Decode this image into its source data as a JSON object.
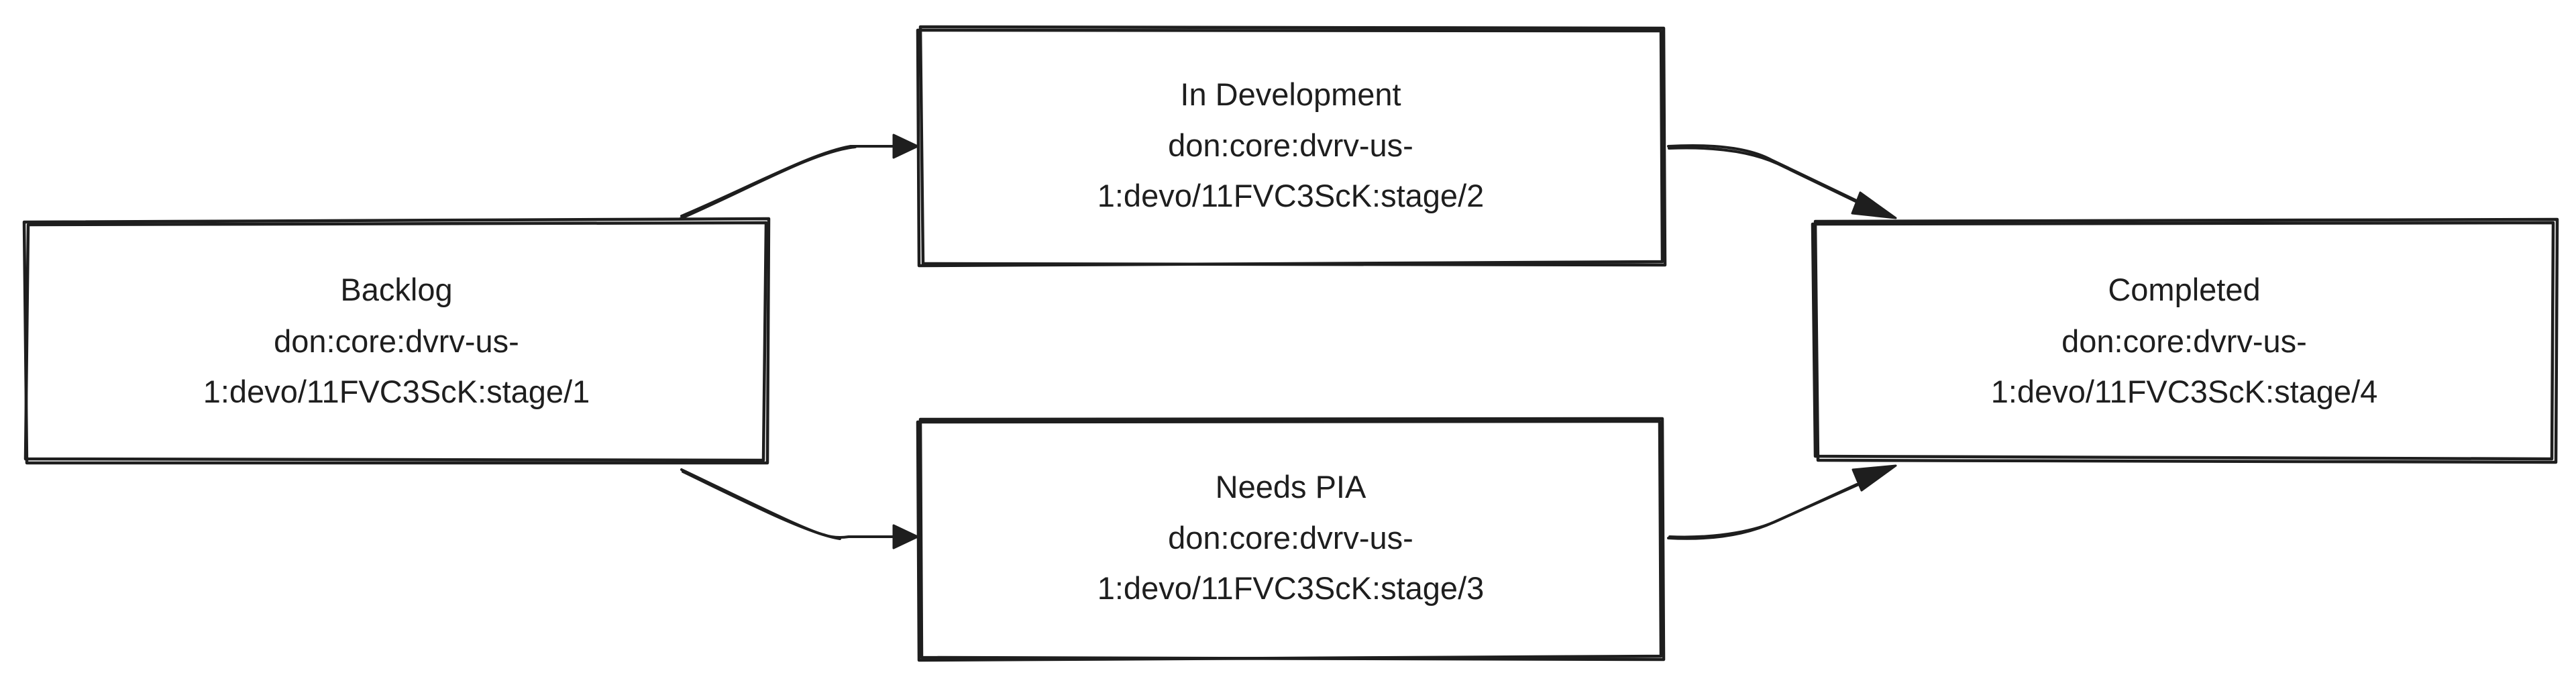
{
  "diagram": {
    "nodes": [
      {
        "id": "backlog",
        "title": "Backlog",
        "line2": "don:core:dvrv-us-",
        "line3": "1:devo/11FVC3ScK:stage/1"
      },
      {
        "id": "in-development",
        "title": "In Development",
        "line2": "don:core:dvrv-us-",
        "line3": "1:devo/11FVC3ScK:stage/2"
      },
      {
        "id": "needs-pia",
        "title": "Needs PIA",
        "line2": "don:core:dvrv-us-",
        "line3": "1:devo/11FVC3ScK:stage/3"
      },
      {
        "id": "completed",
        "title": "Completed",
        "line2": "don:core:dvrv-us-",
        "line3": "1:devo/11FVC3ScK:stage/4"
      }
    ],
    "edges": [
      {
        "from": "backlog",
        "to": "in-development"
      },
      {
        "from": "backlog",
        "to": "needs-pia"
      },
      {
        "from": "in-development",
        "to": "completed"
      },
      {
        "from": "needs-pia",
        "to": "completed"
      }
    ],
    "colors": {
      "stroke": "#1e1e1e",
      "text": "#1e1e1e",
      "background": "#ffffff"
    }
  }
}
